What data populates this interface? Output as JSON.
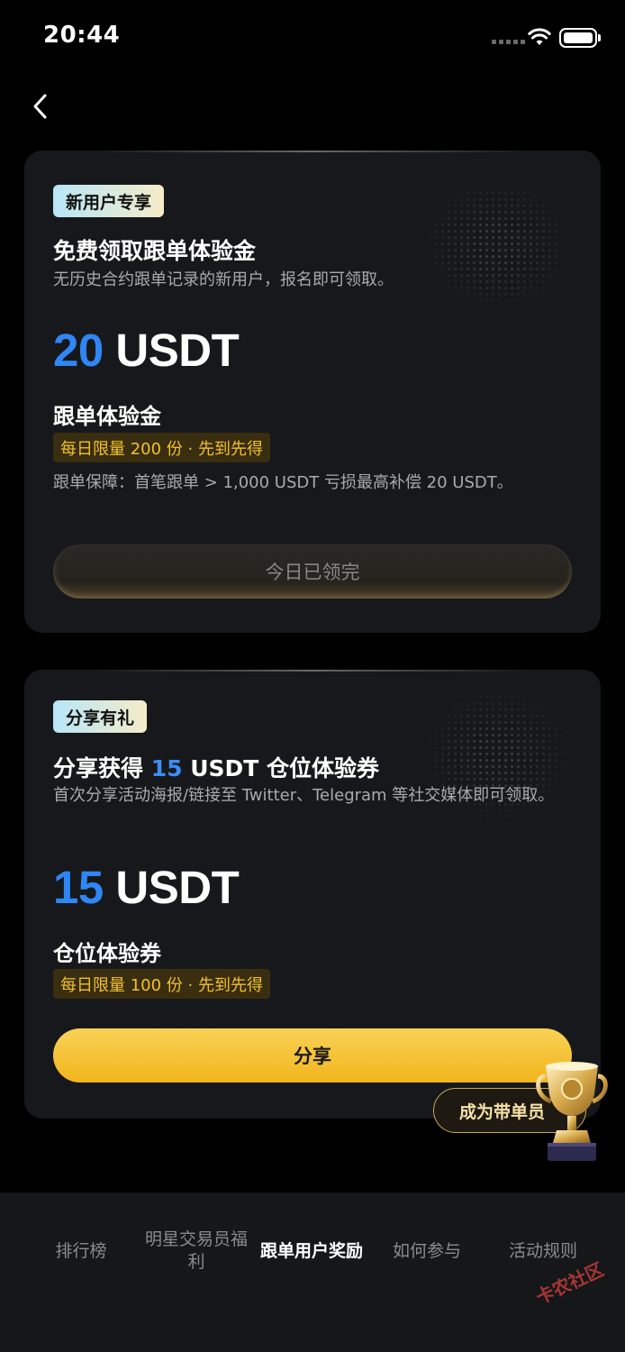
{
  "status_bar": {
    "time": "20:44"
  },
  "card1": {
    "badge": "新用户专享",
    "title": "免费领取跟单体验金",
    "description": "无历史合约跟单记录的新用户，报名即可领取。",
    "amount_number": "20",
    "amount_unit": " USDT",
    "subtitle": "跟单体验金",
    "limit": "每日限量 200 份 · 先到先得",
    "guarantee": "跟单保障：首笔跟单 > 1,000 USDT 亏损最高补偿 20 USDT。",
    "button_label": "今日已领完"
  },
  "card2": {
    "badge": "分享有礼",
    "title_prefix": "分享获得 ",
    "title_highlight": "15",
    "title_suffix": " USDT 仓位体验券",
    "description": "首次分享活动海报/链接至 Twitter、Telegram 等社交媒体即可领取。",
    "amount_number": "15",
    "amount_unit": " USDT",
    "subtitle": "仓位体验券",
    "limit": "每日限量 100 份 · 先到先得",
    "button_label": "分享"
  },
  "floating": {
    "leader_label": "成为带单员"
  },
  "tabs": [
    {
      "label": "排行榜",
      "active": false
    },
    {
      "label": "明星交易员福利",
      "active": false
    },
    {
      "label": "跟单用户奖励",
      "active": true
    },
    {
      "label": "如何参与",
      "active": false
    },
    {
      "label": "活动规则",
      "active": false
    }
  ],
  "watermark": "卡农社区",
  "colors": {
    "accent_blue": "#2f86f5",
    "accent_gold": "#f2b51c",
    "limit_text": "#f2c12e",
    "card_bg": "#17181b"
  }
}
